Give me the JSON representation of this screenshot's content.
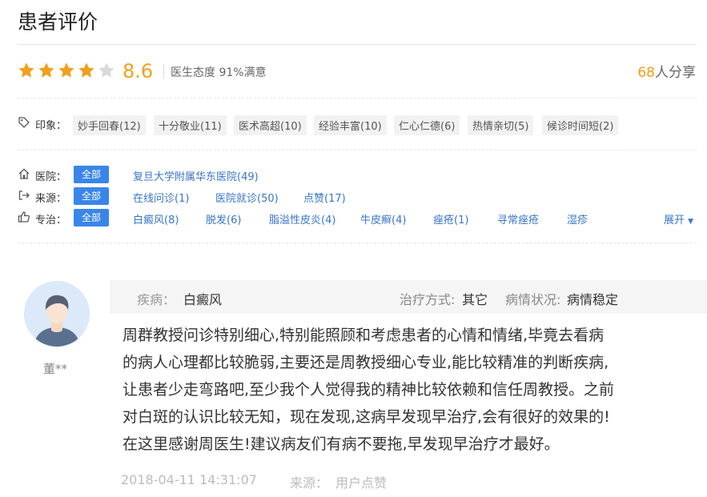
{
  "page": {
    "title": "患者评价"
  },
  "rating": {
    "stars_filled": 4,
    "stars_total": 5,
    "score": "8.6",
    "attitude": "医生态度 91%满意",
    "share_count": "68",
    "share_suffix": "人分享",
    "star_color": "#f0a020",
    "star_empty_color": "#d9d9d9"
  },
  "impressions": {
    "label": "印象：",
    "tags": [
      "妙手回春(12)",
      "十分敬业(11)",
      "医术高超(10)",
      "经验丰富(10)",
      "仁心仁德(6)",
      "热情亲切(5)",
      "候诊时间短(2)"
    ]
  },
  "filters": {
    "hospital": {
      "label": "医院：",
      "all": "全部",
      "items": [
        "复旦大学附属华东医院(49)"
      ]
    },
    "source": {
      "label": "来源：",
      "all": "全部",
      "items": [
        "在线问诊(1)",
        "医院就诊(50)",
        "点赞(17)"
      ]
    },
    "specialty": {
      "label": "专治：",
      "all": "全部",
      "items": [
        "白癜风(8)",
        "脱发(6)",
        "脂溢性皮炎(4)",
        "牛皮癣(4)",
        "痤疮(1)",
        "寻常痤疮",
        "湿疹"
      ],
      "expand": "展开"
    },
    "accent": "#3a86e8"
  },
  "review": {
    "username": "董**",
    "disease_label": "疾病：",
    "disease": "白癜风",
    "treatment_label": "治疗方式:",
    "treatment": "其它",
    "status_label": "病情状况:",
    "status": "病情稳定",
    "lines": [
      "周群教授问诊特别细心,特别能照顾和考虑患者的心情和情绪,毕竟去看病",
      "的病人心理都比较脆弱,主要还是周教授细心专业,能比较精准的判断疾病,",
      "让患者少走弯路吧,至少我个人觉得我的精神比较依赖和信任周教授。之前",
      "对白斑的认识比较无知，现在发现,这病早发现早治疗,会有很好的效果的!",
      "在这里感谢周医生!建议病友们有病不要拖,早发现早治疗才最好。"
    ],
    "date": "2018-04-11 14:31:07",
    "source_label": "来源：",
    "source": "用户点赞"
  }
}
